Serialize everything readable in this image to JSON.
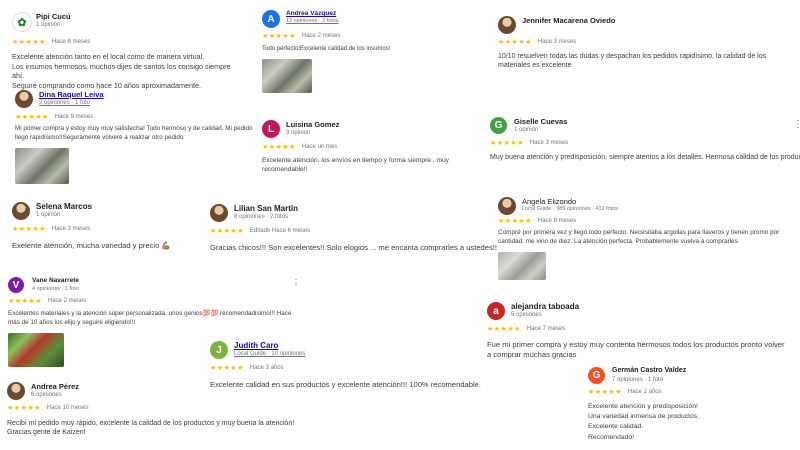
{
  "reviews": [
    {
      "name": "Pipi Cucú",
      "meta": "1 opinión",
      "time": "Hace 8 meses",
      "stars": "★★★★★",
      "text": "Excelente atención tanto en el local como de manera virtual.\nLos insumos hermosos, muchos dijes de santos los consigo siempre ahí.\nSeguiré comprando como hace 10 años aproximadamente.",
      "avatar_color": "#ffffff",
      "avatar_letter": ""
    },
    {
      "name": "Dina Raquel Leiva",
      "meta": "2 opiniones · 1 foto",
      "time": "Hace 9 meses",
      "stars": "★★★★★",
      "text": "Mi primer compra y estoy muy muy satisfecha! Todo hermoso y de calidad. Mi pedido llegó rapidísimo!!Seguramente volveré a realizar otro pedido"
    },
    {
      "name": "Andrea Vázquez",
      "meta": "12 opiniones · 2 fotos",
      "time": "Hace 2 meses",
      "stars": "★★★★★",
      "text": "Todo perfecto!Excelente calidad de los insumos!",
      "avatar_color": "#1a73e8",
      "avatar_letter": "A"
    },
    {
      "name": "Luisina Gomez",
      "meta": "3 opinión",
      "time": "Hace un mes",
      "stars": "★★★★★",
      "text": "Excelente atención, los envíos en tiempo y forma siempre...muy recomendable!!",
      "avatar_color": "#c2185b",
      "avatar_letter": "L"
    },
    {
      "name": "Jennifer Macarena Oviedo",
      "meta": "",
      "time": "Hace 3 meses",
      "stars": "★★★★★",
      "text": "10/10 resuelven todas las dudas y despachan los pedidos rapidísimo, la calidad de los materiales es excelente"
    },
    {
      "name": "Giselle Cuevas",
      "meta": "1 opinión",
      "time": "Hace 3 meses",
      "stars": "★★★★★",
      "text": "Muy buena atención y predisposición, siempre atentos a los detalles. Hermosa calidad de los productos",
      "avatar_color": "#43a047",
      "avatar_letter": "G"
    },
    {
      "name": "Selena Marcos",
      "meta": "1 opinión",
      "time": "Hace 3 meses",
      "stars": "★★★★★",
      "text": "Exelente atención, mucha variedad y precio 💪🏽"
    },
    {
      "name": "Lilian San Martín",
      "meta": "8 opiniones · 2 fotos",
      "time": "Editado Hace 6 meses",
      "stars": "★★★★★",
      "text": "Gracias chicos!!! Son excelentes!! Solo elogios ... me encanta comprarles a ustedes!!"
    },
    {
      "name": "Angela Elizondo",
      "meta": "Local Guide · 389 opiniones · 412 fotos",
      "time": "Hace 8 meses",
      "stars": "★★★★★",
      "text": "Compré por primera vez y llegó todo perfecto. Necesitaba argollas para llaveros y tienen promo por cantidad, me vino de diez. La atención perfecta. Probablemente vuelva a comprarles"
    },
    {
      "name": "Vane Navarrete",
      "meta": "4 opiniones · 1 foto",
      "time": "Hace 2 meses",
      "stars": "★★★★★",
      "text": "Excelentes materiales y la atención súper personalizada, unos genios💯💯 recomendadisimo!!! Hace más de 10 años los elijo y seguiré eligiendo!!!",
      "avatar_color": "#7b1fa2",
      "avatar_letter": "V"
    },
    {
      "name": "Judith Caro",
      "meta": "Local Guide · 10 opiniones",
      "time": "Hace 3 años",
      "stars": "★★★★★",
      "text": "Excelente calidad en sus productos y excelente atención!!! 100% recomendable.",
      "avatar_color": "#7cb342",
      "avatar_letter": "J"
    },
    {
      "name": "alejandra taboada",
      "meta": "5 opiniones",
      "time": "Hace 7 meses",
      "stars": "★★★★★",
      "text": "Fue mi primer compra y estoy muy contenta hermosos todos los productos pronto volver a comprar muchas gracias",
      "avatar_color": "#c62828",
      "avatar_letter": "a"
    },
    {
      "name": "Andrea Pérez",
      "meta": "6 opiniones",
      "time": "Hace 10 meses",
      "stars": "★★★★★",
      "text": "Recibí mi pedido muy rápido, excelente la calidad de los productos y muy buena la atención! Gracias gente de Kaizen!"
    },
    {
      "name": "Germán Castro Valdez",
      "meta": "7 opiniones · 1 foto",
      "time": "Hace 2 años",
      "stars": "★★★★★",
      "text": "Excelente atención y predisposición!\nUna variedad inmensa de productos.\nExcelente calidad.\nRecomendado!",
      "avatar_color": "#f4511e",
      "avatar_letter": "G"
    }
  ]
}
